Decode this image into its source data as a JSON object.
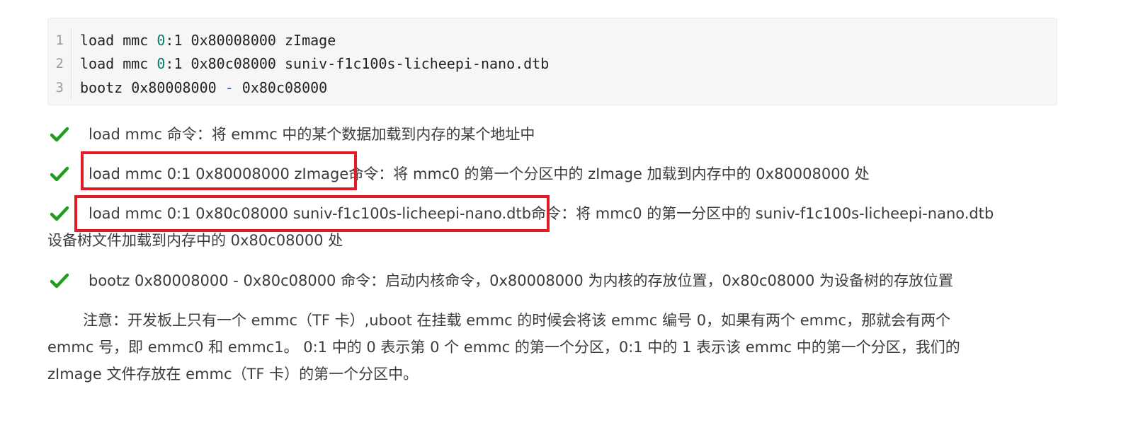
{
  "code": {
    "lines": [
      {
        "no": "1",
        "pre": "load mmc ",
        "num": "0",
        "post": ":1 0x80008000 zImage"
      },
      {
        "no": "2",
        "pre": "load mmc ",
        "num": "0",
        "post": ":1 0x80c08000 suniv-f1c100s-licheepi-nano.dtb"
      },
      {
        "no": "3",
        "pre": "bootz 0x80008000 ",
        "op": "-",
        "post": " 0x80c08000"
      }
    ]
  },
  "bullets": [
    {
      "text": "load mmc 命令：将 emmc 中的某个数据加载到内存的某个地址中"
    },
    {
      "boxed": "load mmc 0:1 0x80008000 zImage",
      "rest": "命令：将 mmc0 的第一个分区中的 zImage 加载到内存中的 0x80008000 处"
    },
    {
      "boxed": "load mmc 0:1 0x80c08000 suniv-f1c100s-licheepi-nano.dtb",
      "rest": "命令：将 mmc0  的第一分区中的 suniv-f1c100s-licheepi-nano.dtb",
      "cont": "设备树文件加载到内存中的 0x80c08000 处"
    },
    {
      "text": "bootz 0x80008000 - 0x80c08000 命令：启动内核命令，0x80008000 为内核的存放位置，0x80c08000 为设备树的存放位置"
    }
  ],
  "note": {
    "line1": "注意：开发板上只有一个 emmc（TF 卡）,uboot 在挂载 emmc 的时候会将该 emmc 编号 0，如果有两个 emmc，那就会有两个",
    "line2": "emmc 号，即 emmc0 和 emmc1。 0:1 中的 0 表示第 0 个 emmc 的第一个分区，0:1 中的 1 表示该 emmc 中的第一个分区，我们的",
    "line3": "zImage 文件存放在 emmc（TF 卡）的第一个分区中。"
  },
  "colors": {
    "check": "#1f9d1f",
    "highlight": "#e21b25"
  },
  "icons": {
    "check": "check-icon"
  }
}
